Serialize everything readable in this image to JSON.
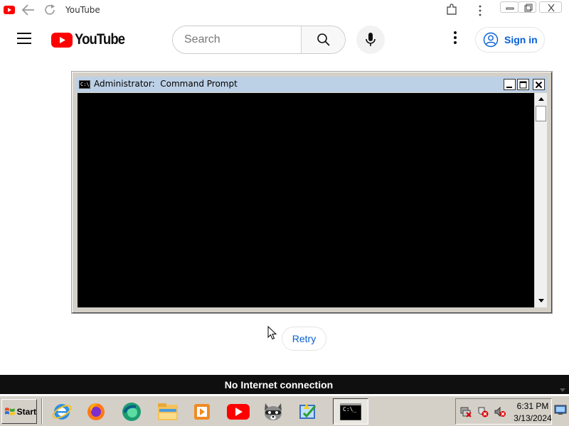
{
  "browser": {
    "tab_title": "YouTube",
    "icons": [
      "youtube-favicon",
      "back-arrow",
      "reload",
      "extensions",
      "menu-dots",
      "minimize",
      "restore",
      "close"
    ]
  },
  "youtube": {
    "logo_text": "YouTube",
    "search_placeholder": "Search",
    "search_value": "",
    "signin_label": "Sign in",
    "retry_label": "Retry",
    "offline_message": "No Internet connection",
    "brand_red": "#ff0000",
    "link_blue": "#065fd4"
  },
  "cmd_window": {
    "title": "Administrator:  Command Prompt",
    "icon_text": "C:\\",
    "console_color": "#000000",
    "titlebar_color": "#bdd1e6"
  },
  "taskbar": {
    "start_label": "Start",
    "quick_launch": [
      "internet-explorer",
      "firefox",
      "edge",
      "file-explorer",
      "media-player",
      "youtube",
      "raccoon-app",
      "setup-wizard"
    ],
    "active_task_icon_text": "C:\\_",
    "tray_icons": [
      "network-disconnected",
      "security-alert",
      "volume-muted"
    ],
    "clock_time": "6:31 PM",
    "clock_date": "3/13/2024"
  }
}
